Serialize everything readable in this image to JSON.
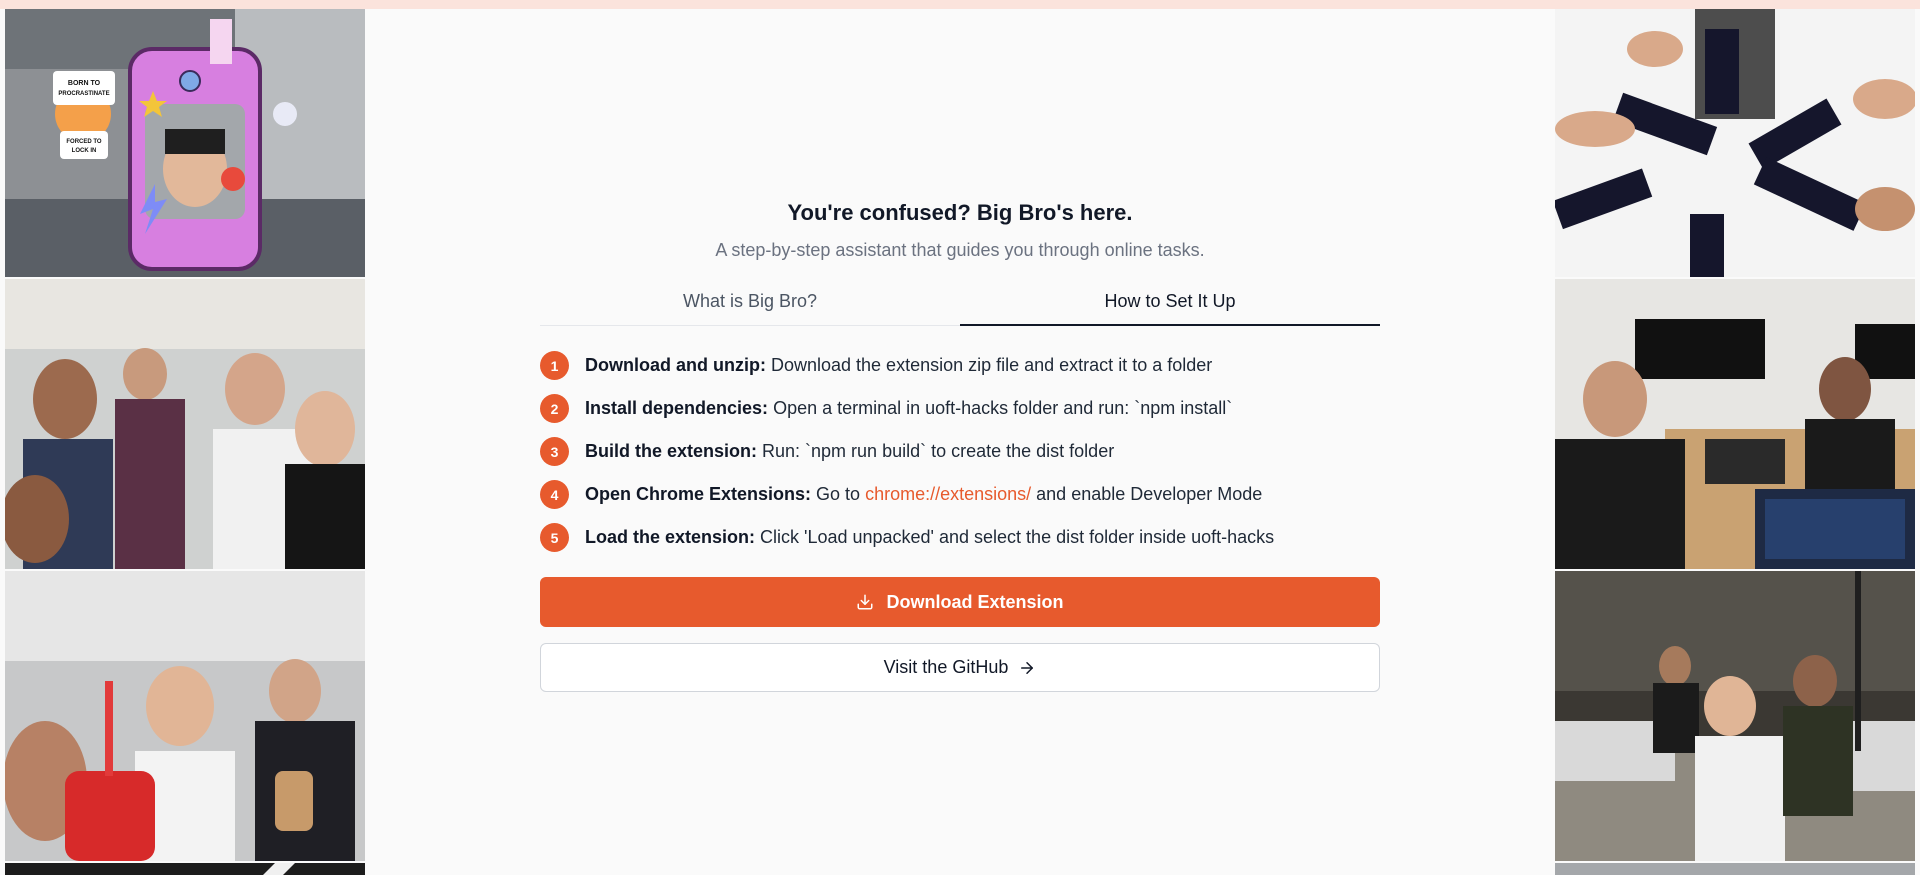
{
  "header": {
    "title": "You're confused? Big Bro's here.",
    "subtitle": "A step-by-step assistant that guides you through online tasks."
  },
  "tabs": [
    {
      "label": "What is Big Bro?",
      "active": false
    },
    {
      "label": "How to Set It Up",
      "active": true
    }
  ],
  "steps": [
    {
      "num": "1",
      "title": "Download and unzip:",
      "text": "Download the extension zip file and extract it to a folder"
    },
    {
      "num": "2",
      "title": "Install dependencies:",
      "text": "Open a terminal in uoft-hacks folder and run: `npm install`"
    },
    {
      "num": "3",
      "title": "Build the extension:",
      "text": "Run: `npm run build` to create the dist folder"
    },
    {
      "num": "4",
      "title": "Open Chrome Extensions:",
      "text_before": "Go to",
      "link": "chrome://extensions/",
      "text_after": "and enable Developer Mode"
    },
    {
      "num": "5",
      "title": "Load the extension:",
      "text": "Click 'Load unpacked' and select the dist folder inside uoft-hacks"
    }
  ],
  "buttons": {
    "download": "Download Extension",
    "github": "Visit the GitHub"
  },
  "sticker": {
    "top": "BORN TO PROCRASTINATE",
    "bottom": "FORCED TO LOCK IN"
  },
  "colors": {
    "accent": "#e75a2d",
    "background": "#fafafa",
    "topbar": "#fbe3dc"
  },
  "icons": {
    "download": "download-icon",
    "github": "arrow-right-icon"
  }
}
